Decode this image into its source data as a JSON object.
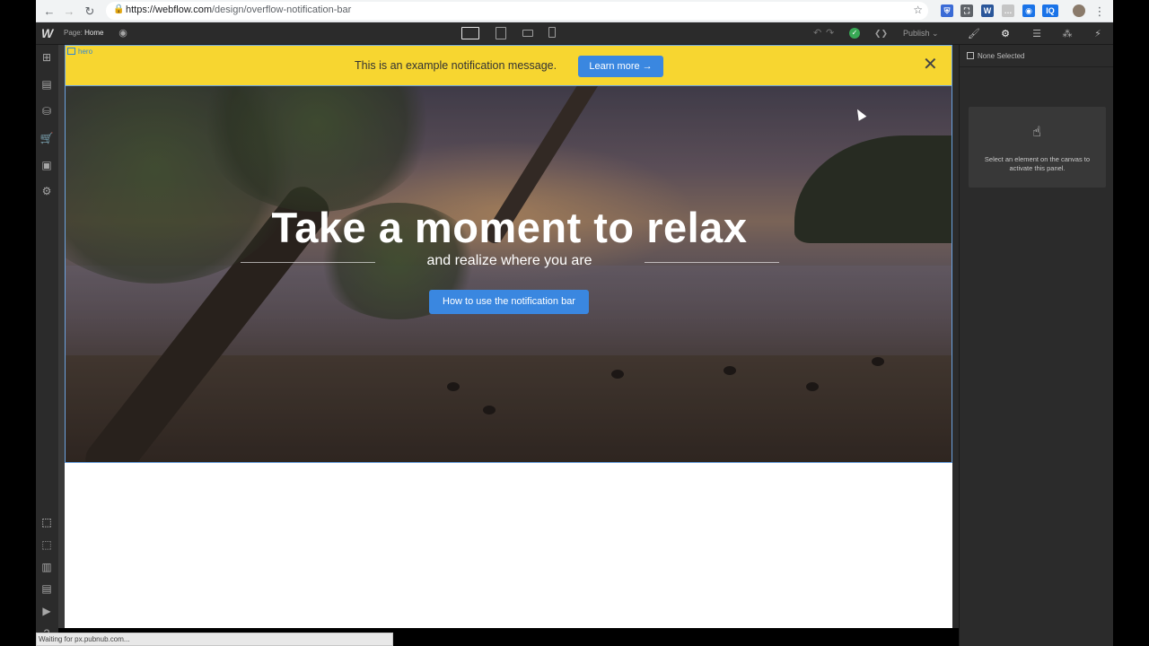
{
  "browser": {
    "url_host": "https://webflow.com",
    "url_path": "/design/overflow-notification-bar",
    "back_glyph": "←",
    "forward_glyph": "→",
    "reload_glyph": "↻",
    "lock_glyph": "🔒",
    "star_glyph": "☆",
    "menu_glyph": "⋮",
    "extensions": [
      {
        "name": "shield-extension-icon",
        "color": "#3b6bd6",
        "glyph": "⛨"
      },
      {
        "name": "screenshot-extension-icon",
        "color": "#5f6368",
        "glyph": "⛶"
      },
      {
        "name": "word-extension-icon",
        "color": "#2b579a",
        "glyph": "W"
      },
      {
        "name": "chat-extension-icon",
        "color": "#c5c5c5",
        "glyph": "…"
      },
      {
        "name": "blue-extension-icon",
        "color": "#1a73e8",
        "glyph": "◉"
      },
      {
        "name": "iq-extension-icon",
        "color": "#1a73e8",
        "glyph": "IQ"
      }
    ]
  },
  "toolbar": {
    "logo": "W",
    "page_prefix": "Page:",
    "page_name": "Home",
    "publish_label": "Publish",
    "check_glyph": "✓",
    "code_glyph": "❮❯",
    "undo_glyph": "↶",
    "redo_glyph": "↷",
    "right_tabs": [
      "🖌",
      "⚙",
      "☰",
      "⁂",
      "⚡"
    ]
  },
  "sidebar": {
    "icons": [
      {
        "name": "add-panel-icon",
        "glyph": "⊞"
      },
      {
        "name": "pages-icon",
        "glyph": "▤"
      },
      {
        "name": "cms-icon",
        "glyph": "⛁"
      },
      {
        "name": "ecommerce-icon",
        "glyph": "🛒"
      },
      {
        "name": "assets-icon",
        "glyph": "▣"
      },
      {
        "name": "settings-icon",
        "glyph": "⚙"
      }
    ],
    "bottom_icons": [
      {
        "name": "select-mode-icon",
        "glyph": "⬚"
      },
      {
        "name": "preview-outline-icon",
        "glyph": "⬚"
      },
      {
        "name": "grid-icon",
        "glyph": "▥"
      },
      {
        "name": "layout-icon",
        "glyph": "▤"
      },
      {
        "name": "video-icon",
        "glyph": "▶"
      },
      {
        "name": "help-icon",
        "glyph": "?"
      }
    ]
  },
  "canvas": {
    "hero_tag": "hero",
    "notification_text": "This is an example notification message.",
    "learn_more_label": "Learn more →",
    "close_glyph": "✕",
    "hero_title": "Take a moment to relax",
    "hero_subtitle": "and realize where you are",
    "howto_label": "How to use the notification bar"
  },
  "right_panel": {
    "none_selected": "None Selected",
    "hand_glyph": "☝",
    "empty_text": "Select an element on the canvas to activate this panel."
  },
  "status": {
    "text": "Waiting for px.pubnub.com..."
  },
  "colors": {
    "notification_bg": "#f7d630",
    "button_blue": "#3a87e0",
    "panel_bg": "#2b2b2b"
  }
}
